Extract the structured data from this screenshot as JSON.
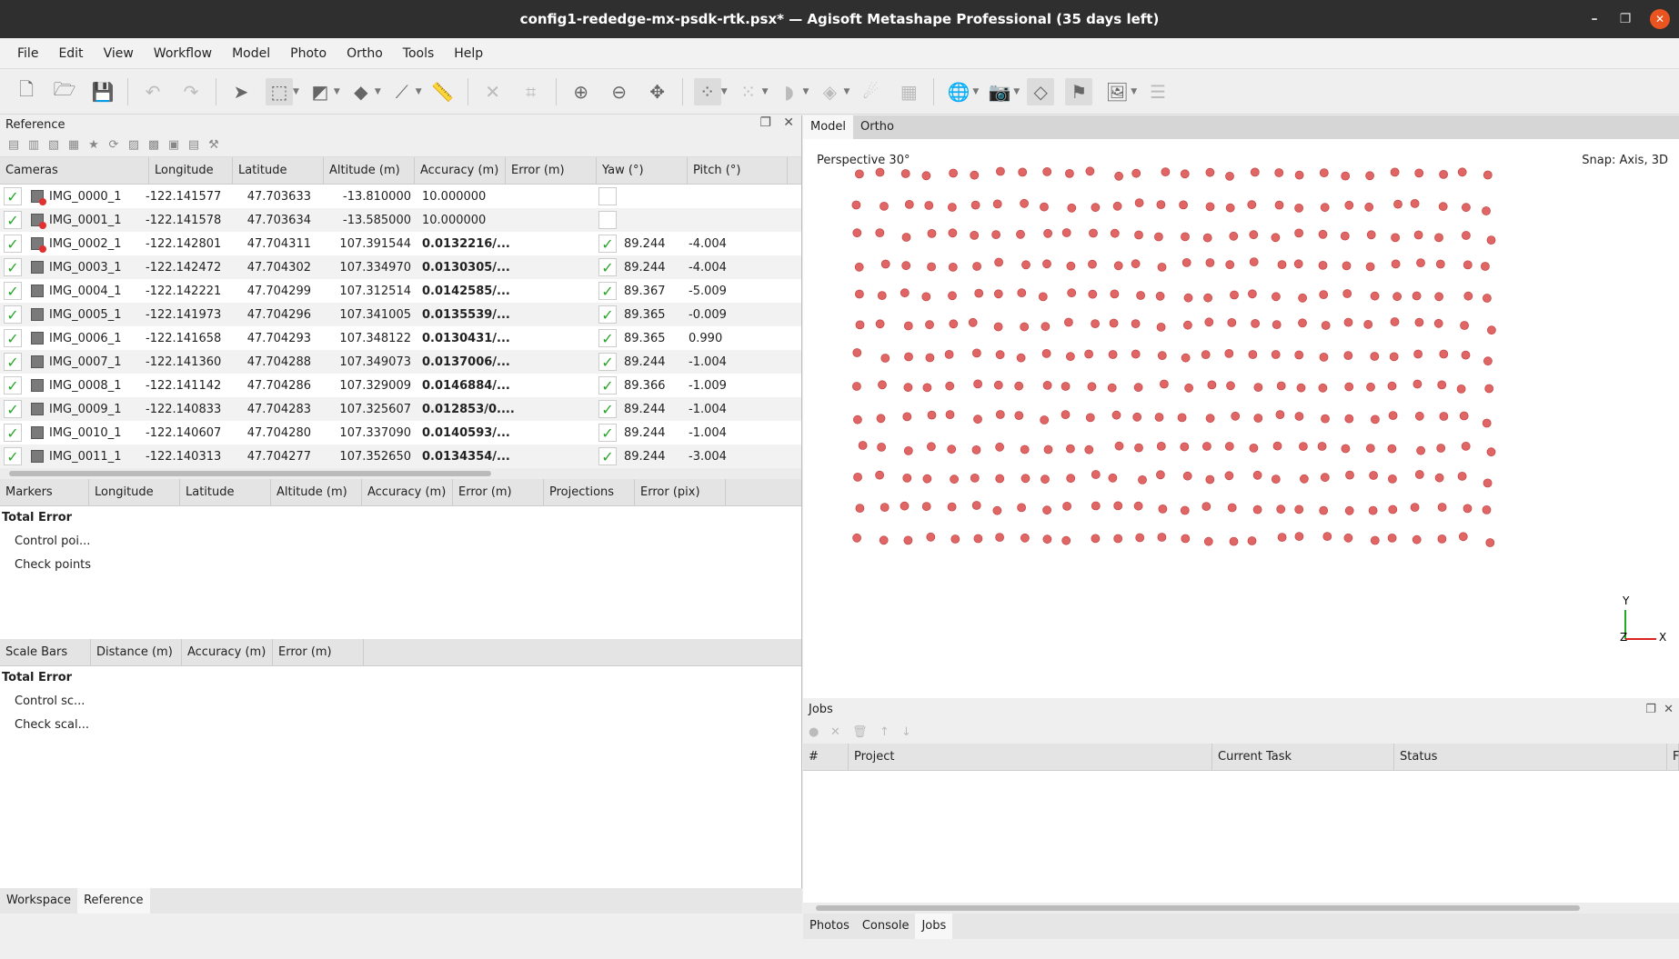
{
  "window": {
    "title": "config1-rededge-mx-psdk-rtk.psx* — Agisoft Metashape Professional (35 days left)"
  },
  "menu": [
    "File",
    "Edit",
    "View",
    "Workflow",
    "Model",
    "Photo",
    "Ortho",
    "Tools",
    "Help"
  ],
  "reference": {
    "title": "Reference",
    "columns": [
      "Cameras",
      "Longitude",
      "Latitude",
      "Altitude (m)",
      "Accuracy (m)",
      "Error (m)",
      "Yaw (°)",
      "Pitch (°)"
    ],
    "rows": [
      {
        "name": "IMG_0000_1",
        "lon": "-122.141577",
        "lat": "47.703633",
        "alt": "-13.810000",
        "acc": "10.000000",
        "acc_bold": false,
        "yaw_checked": false,
        "yaw": "",
        "pitch": "",
        "bad": true
      },
      {
        "name": "IMG_0001_1",
        "lon": "-122.141578",
        "lat": "47.703634",
        "alt": "-13.585000",
        "acc": "10.000000",
        "acc_bold": false,
        "yaw_checked": false,
        "yaw": "",
        "pitch": "",
        "bad": true
      },
      {
        "name": "IMG_0002_1",
        "lon": "-122.142801",
        "lat": "47.704311",
        "alt": "107.391544",
        "acc": "0.0132216/...",
        "acc_bold": true,
        "yaw_checked": true,
        "yaw": "89.244",
        "pitch": "-4.004",
        "bad": true
      },
      {
        "name": "IMG_0003_1",
        "lon": "-122.142472",
        "lat": "47.704302",
        "alt": "107.334970",
        "acc": "0.0130305/...",
        "acc_bold": true,
        "yaw_checked": true,
        "yaw": "89.244",
        "pitch": "-4.004",
        "bad": false
      },
      {
        "name": "IMG_0004_1",
        "lon": "-122.142221",
        "lat": "47.704299",
        "alt": "107.312514",
        "acc": "0.0142585/...",
        "acc_bold": true,
        "yaw_checked": true,
        "yaw": "89.367",
        "pitch": "-5.009",
        "bad": false
      },
      {
        "name": "IMG_0005_1",
        "lon": "-122.141973",
        "lat": "47.704296",
        "alt": "107.341005",
        "acc": "0.0135539/...",
        "acc_bold": true,
        "yaw_checked": true,
        "yaw": "89.365",
        "pitch": "-0.009",
        "bad": false
      },
      {
        "name": "IMG_0006_1",
        "lon": "-122.141658",
        "lat": "47.704293",
        "alt": "107.348122",
        "acc": "0.0130431/...",
        "acc_bold": true,
        "yaw_checked": true,
        "yaw": "89.365",
        "pitch": "0.990",
        "bad": false
      },
      {
        "name": "IMG_0007_1",
        "lon": "-122.141360",
        "lat": "47.704288",
        "alt": "107.349073",
        "acc": "0.0137006/...",
        "acc_bold": true,
        "yaw_checked": true,
        "yaw": "89.244",
        "pitch": "-1.004",
        "bad": false
      },
      {
        "name": "IMG_0008_1",
        "lon": "-122.141142",
        "lat": "47.704286",
        "alt": "107.329009",
        "acc": "0.0146884/...",
        "acc_bold": true,
        "yaw_checked": true,
        "yaw": "89.366",
        "pitch": "-1.009",
        "bad": false
      },
      {
        "name": "IMG_0009_1",
        "lon": "-122.140833",
        "lat": "47.704283",
        "alt": "107.325607",
        "acc": "0.012853/0....",
        "acc_bold": true,
        "yaw_checked": true,
        "yaw": "89.244",
        "pitch": "-1.004",
        "bad": false
      },
      {
        "name": "IMG_0010_1",
        "lon": "-122.140607",
        "lat": "47.704280",
        "alt": "107.337090",
        "acc": "0.0140593/...",
        "acc_bold": true,
        "yaw_checked": true,
        "yaw": "89.244",
        "pitch": "-1.004",
        "bad": false
      },
      {
        "name": "IMG_0011_1",
        "lon": "-122.140313",
        "lat": "47.704277",
        "alt": "107.352650",
        "acc": "0.0134354/...",
        "acc_bold": true,
        "yaw_checked": true,
        "yaw": "89.244",
        "pitch": "-3.004",
        "bad": false
      }
    ]
  },
  "markers": {
    "columns": [
      "Markers",
      "Longitude",
      "Latitude",
      "Altitude (m)",
      "Accuracy (m)",
      "Error (m)",
      "Projections",
      "Error (pix)"
    ],
    "items": [
      "Total Error",
      "Control poi...",
      "Check points"
    ]
  },
  "scalebars": {
    "columns": [
      "Scale Bars",
      "Distance (m)",
      "Accuracy (m)",
      "Error (m)"
    ],
    "items": [
      "Total Error",
      "Control sc...",
      "Check scal..."
    ]
  },
  "left_tabs": [
    "Workspace",
    "Reference"
  ],
  "view_tabs": [
    "Model",
    "Ortho"
  ],
  "viewport": {
    "projection": "Perspective 30°",
    "snap": "Snap: Axis, 3D",
    "axis_y": "Y",
    "axis_z": "Z",
    "axis_x": "X"
  },
  "jobs": {
    "title": "Jobs",
    "columns": [
      "#",
      "Project",
      "Current Task",
      "Status",
      "F"
    ]
  },
  "right_tabs": [
    "Photos",
    "Console",
    "Jobs"
  ],
  "colors": {
    "camera_point": "#e06666",
    "check": "#2aa52a"
  }
}
